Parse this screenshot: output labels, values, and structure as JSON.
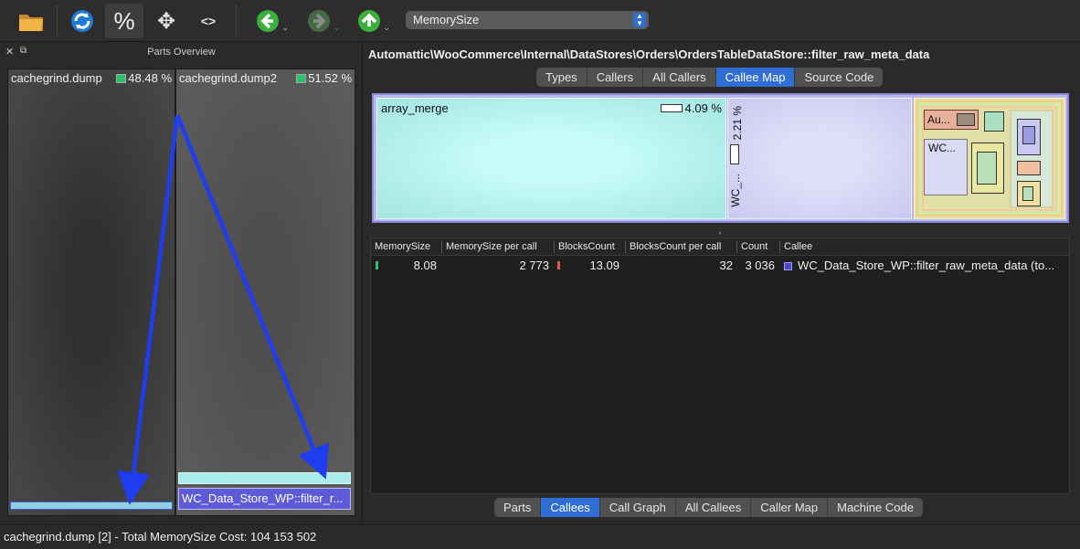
{
  "toolbar": {
    "buttons": [
      {
        "name": "open-folder-icon",
        "glyph": "folder"
      },
      {
        "name": "reload-icon",
        "glyph": "reload"
      },
      {
        "name": "percentage-icon",
        "glyph": "%"
      },
      {
        "name": "move-icon",
        "glyph": "✥"
      },
      {
        "name": "code-icon",
        "glyph": "<>"
      },
      {
        "name": "back-icon",
        "glyph": "←"
      },
      {
        "name": "forward-icon",
        "glyph": "→"
      },
      {
        "name": "up-icon",
        "glyph": "↑"
      }
    ],
    "metric": "MemorySize"
  },
  "parts_overview": {
    "title": "Parts Overview",
    "parts": [
      {
        "label": "cachegrind.dump",
        "pct": "48.48 %"
      },
      {
        "label": "cachegrind.dump2",
        "pct": "51.52 %"
      }
    ],
    "bottom_function": "WC_Data_Store_WP::filter_r..."
  },
  "function_title": "Automattic\\WooCommerce\\Internal\\DataStores\\Orders\\OrdersTableDataStore::filter_raw_meta_data",
  "top_tabs": [
    {
      "label": "Types",
      "active": false
    },
    {
      "label": "Callers",
      "active": false
    },
    {
      "label": "All Callers",
      "active": false
    },
    {
      "label": "Callee Map",
      "active": true
    },
    {
      "label": "Source Code",
      "active": false
    }
  ],
  "callee_map": {
    "main_label": "array_merge",
    "main_pct": "4.09 %",
    "second_pct": "2.21 %",
    "second_label": "WC_...",
    "nested_label_1": "Au...",
    "nested_label_2": "WC..."
  },
  "table": {
    "columns": [
      "MemorySize",
      "MemorySize per call",
      "BlocksCount",
      "BlocksCount per call",
      "Count",
      "Callee"
    ],
    "rows": [
      {
        "memory_size": "8.08",
        "memory_size_per_call": "2 773",
        "blocks_count": "13.09",
        "blocks_count_per_call": "32",
        "count": "3 036",
        "callee": "WC_Data_Store_WP::filter_raw_meta_data (to..."
      }
    ]
  },
  "bottom_tabs": [
    {
      "label": "Parts",
      "active": false
    },
    {
      "label": "Callees",
      "active": true
    },
    {
      "label": "Call Graph",
      "active": false
    },
    {
      "label": "All Callees",
      "active": false
    },
    {
      "label": "Caller Map",
      "active": false
    },
    {
      "label": "Machine Code",
      "active": false
    }
  ],
  "status": "cachegrind.dump [2] - Total MemorySize Cost: 104 153 502",
  "colors": {
    "accent": "#2f6ed4",
    "annotation_arrow": "#1f3df0",
    "callee_main": "#b8f4f1",
    "callee_secondary": "#d6d5f5",
    "pct_indicator": "#27c26a"
  }
}
